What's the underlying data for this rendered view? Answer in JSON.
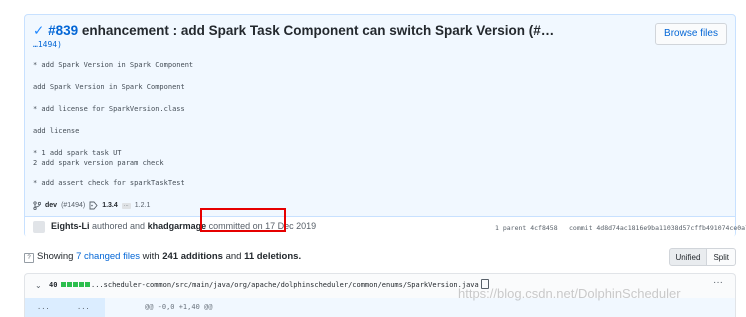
{
  "commit": {
    "check_glyph": "✓",
    "number": "#839",
    "title": "enhancement : add Spark Task Component can switch Spark Version (#…",
    "ref_line": "…1494)",
    "browse_label": "Browse files",
    "message_lines": [
      "* add Spark Version in Spark Component",
      "add Spark Version in Spark Component",
      "* add license for SparkVersion.class",
      "add license",
      "* 1 add spark task UT",
      "2 add spark version param check",
      "* add assert check for sparkTaskTest"
    ],
    "branch": "dev",
    "branch_ref": "(#1494)",
    "tag": "1.3.4",
    "more_tags": "…",
    "tag2": "1.2.1",
    "author": "Eights-Li",
    "authored_text": "authored and",
    "committer": "khadgarmage",
    "committed_text": "committed on 17 Dec 2019",
    "parent": "1 parent 4cf8458",
    "sha": "commit 4d8d74ac1816e9ba11038d57cffb491074ce0a78"
  },
  "summary": {
    "prefix": "Showing",
    "changed_files": "7 changed files",
    "with": "with",
    "additions": "241 additions",
    "and": "and",
    "deletions": "11 deletions."
  },
  "view_toggle": {
    "unified": "Unified",
    "split": "Split"
  },
  "file": {
    "expand_glyph": "⌄",
    "count": "40",
    "path": "...scheduler-common/src/main/java/org/apache/dolphinscheduler/common/enums/SparkVersion.java",
    "more": "···",
    "hunk_left": "...",
    "hunk_right": "...",
    "hunk_header": "@@ -0,0 +1,40 @@"
  },
  "watermark": "https://blog.csdn.net/DolphinScheduler",
  "colors": {
    "accent": "#0366d6",
    "added": "#2cbe4e",
    "highlight_box": "#e60000"
  }
}
